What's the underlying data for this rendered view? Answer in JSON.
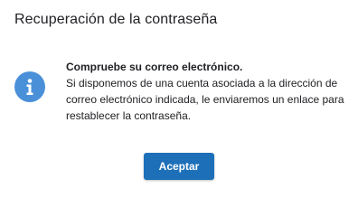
{
  "dialog": {
    "title": "Recuperación de la contraseña",
    "icon": "info-icon",
    "message_heading": "Compruebe su correo electrónico.",
    "message_body": "Si disponemos de una cuenta asociada a la dirección de\ncorreo electrónico indicada, le enviaremos un enlace para\nrestablecer la contraseña.",
    "accept_label": "Aceptar"
  },
  "colors": {
    "accent": "#1d70b8",
    "icon": "#4a90d9",
    "text": "#202124"
  }
}
